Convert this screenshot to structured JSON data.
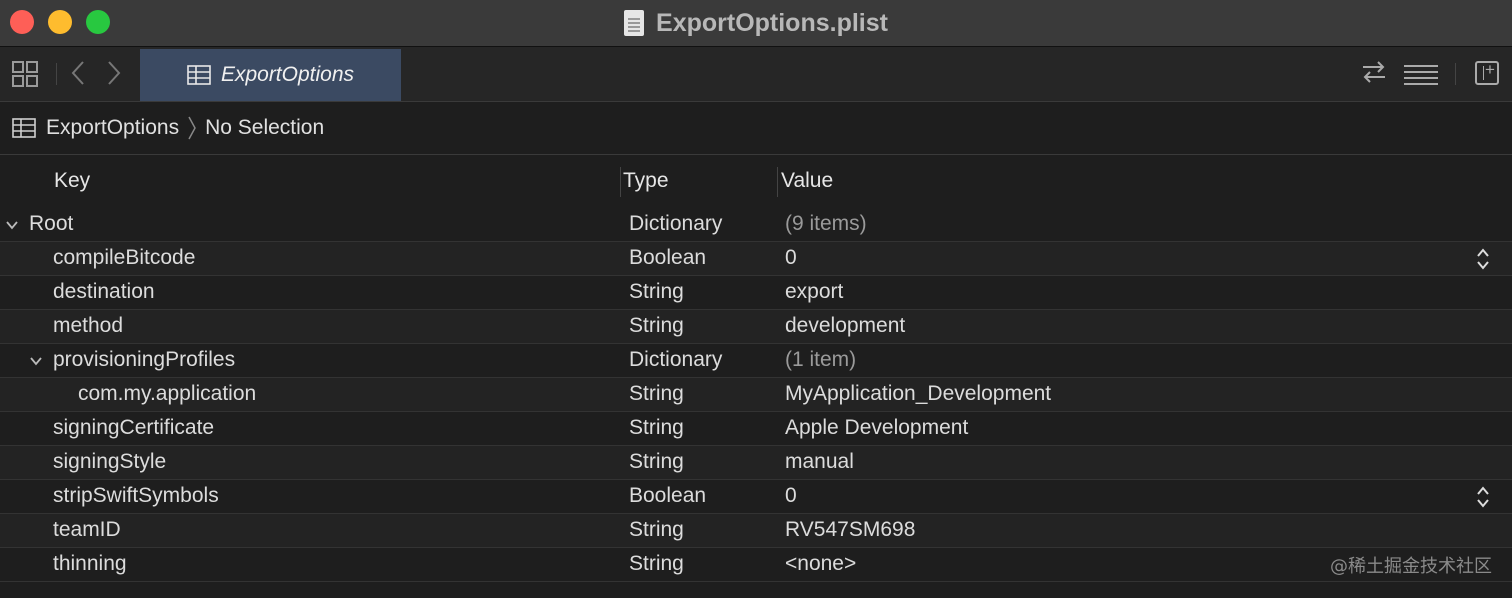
{
  "window": {
    "title": "ExportOptions.plist"
  },
  "toolbar": {
    "tab_label": "ExportOptions",
    "icons": [
      "grid-icon",
      "chevron-left-icon",
      "chevron-right-icon",
      "swap-arrows-icon",
      "lines-icon",
      "add-editor-icon"
    ]
  },
  "jumpbar": {
    "file": "ExportOptions",
    "selection": "No Selection"
  },
  "table": {
    "headers": {
      "key": "Key",
      "type": "Type",
      "value": "Value"
    },
    "rows": [
      {
        "key": "Root",
        "type": "Dictionary",
        "value": "(9 items)",
        "level": 0,
        "expanded": true
      },
      {
        "key": "compileBitcode",
        "type": "Boolean",
        "value": "0",
        "level": 1,
        "stepper": true
      },
      {
        "key": "destination",
        "type": "String",
        "value": "export",
        "level": 1
      },
      {
        "key": "method",
        "type": "String",
        "value": "development",
        "level": 1
      },
      {
        "key": "provisioningProfiles",
        "type": "Dictionary",
        "value": "(1 item)",
        "level": 1,
        "expanded": true
      },
      {
        "key": "com.my.application",
        "type": "String",
        "value": "MyApplication_Development",
        "level": 2
      },
      {
        "key": "signingCertificate",
        "type": "String",
        "value": "Apple Development",
        "level": 1
      },
      {
        "key": "signingStyle",
        "type": "String",
        "value": "manual",
        "level": 1
      },
      {
        "key": "stripSwiftSymbols",
        "type": "Boolean",
        "value": "0",
        "level": 1,
        "stepper": true
      },
      {
        "key": "teamID",
        "type": "String",
        "value": "RV547SM698",
        "level": 1
      },
      {
        "key": "thinning",
        "type": "String",
        "value": "<none>",
        "level": 1
      }
    ]
  },
  "watermark": "@稀土掘金技术社区",
  "colors": {
    "close": "#fe5f57",
    "minimize": "#febc2e",
    "maximize": "#28c840",
    "tab_selected": "#3b4a62"
  }
}
